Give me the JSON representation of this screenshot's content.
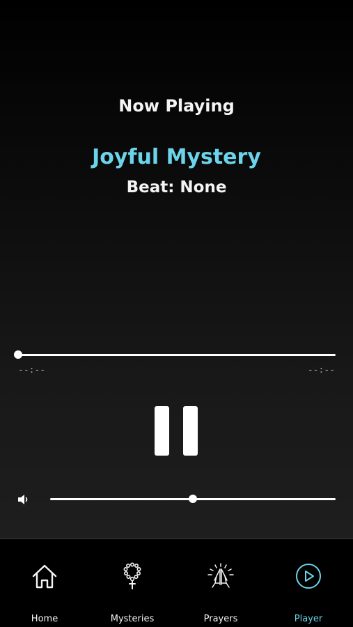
{
  "header": {
    "now_playing": "Now Playing",
    "track_title": "Joyful Mystery",
    "beat": "Beat: None"
  },
  "playback": {
    "elapsed": "--:--",
    "remaining": "--:--",
    "progress": 0,
    "state": "playing",
    "control_icon": "pause-icon"
  },
  "volume": {
    "icon": "speaker-icon",
    "level": 0.5
  },
  "tabbar": {
    "items": [
      {
        "label": "Home",
        "icon": "home-icon",
        "active": false
      },
      {
        "label": "Mysteries",
        "icon": "rosary-icon",
        "active": false
      },
      {
        "label": "Prayers",
        "icon": "praying-hands-icon",
        "active": false
      },
      {
        "label": "Player",
        "icon": "play-circle-icon",
        "active": true
      }
    ]
  },
  "colors": {
    "accent": "#6cd4ea",
    "text": "#f4f4f4",
    "background": "#000000"
  }
}
